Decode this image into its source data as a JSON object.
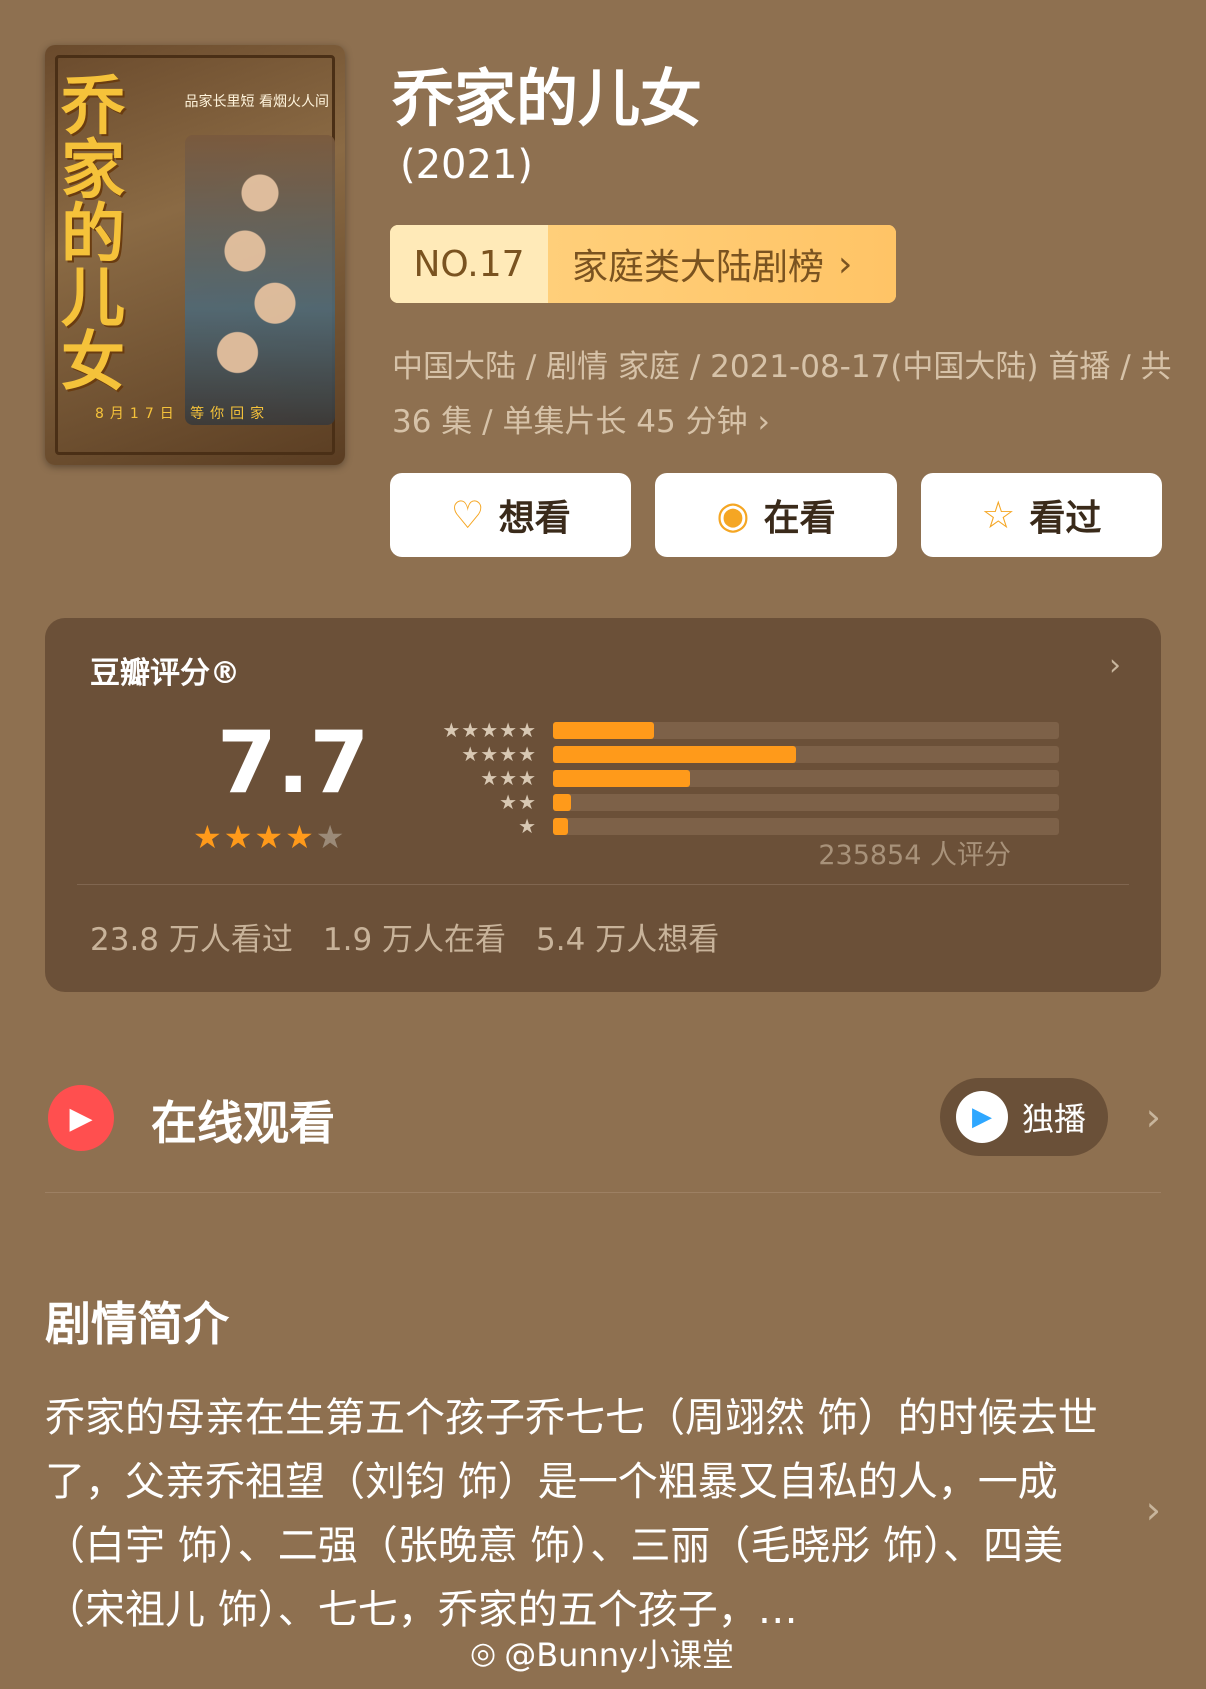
{
  "poster": {
    "title_art": "乔家的儿女",
    "tagline": "品家长里短  看烟火人间",
    "date_line": "8月17日  等你回家"
  },
  "show": {
    "title": "乔家的儿女",
    "year": "(2021)"
  },
  "rank": {
    "number": "NO.17",
    "category": "家庭类大陆剧榜",
    "chevron": "›"
  },
  "meta": {
    "line": "中国大陆 / 剧情 家庭 / 2021-08-17(中国大陆) 首播 / 共 36 集 / 单集片长 45 分钟",
    "chevron": "›"
  },
  "actions": [
    {
      "label": "想看",
      "icon": "heart-plus-icon",
      "glyph": "♡"
    },
    {
      "label": "在看",
      "icon": "target-icon",
      "glyph": "◉"
    },
    {
      "label": "看过",
      "icon": "star-outline-icon",
      "glyph": "☆"
    }
  ],
  "rating": {
    "label": "豆瓣评分®",
    "score": "7.7",
    "stars_full": 4,
    "stars_total": 5,
    "count_text": "235854 人评分",
    "distribution": [
      {
        "stars": "★★★★★",
        "fraction": 0.2
      },
      {
        "stars": "★★★★",
        "fraction": 0.48
      },
      {
        "stars": "★★★",
        "fraction": 0.27
      },
      {
        "stars": "★★",
        "fraction": 0.035
      },
      {
        "stars": "★",
        "fraction": 0.03
      }
    ],
    "watched": "23.8 万人看过",
    "watching": "1.9 万人在看",
    "want": "5.4 万人想看",
    "accent": "#ff9a1a"
  },
  "online": {
    "label": "在线观看",
    "exclusive": "独播",
    "chevron": "›"
  },
  "synopsis": {
    "title": "剧情简介",
    "text": "乔家的母亲在生第五个孩子乔七七（周翊然 饰）的时候去世了，父亲乔祖望（刘钧 饰）是一个粗暴又自私的人，一成（白宇 饰）、二强（张晚意 饰）、三丽（毛晓彤 饰）、四美（宋祖儿 饰）、七七，乔家的五个孩子，…",
    "chevron": "›"
  },
  "watermark": "@Bunny小课堂"
}
